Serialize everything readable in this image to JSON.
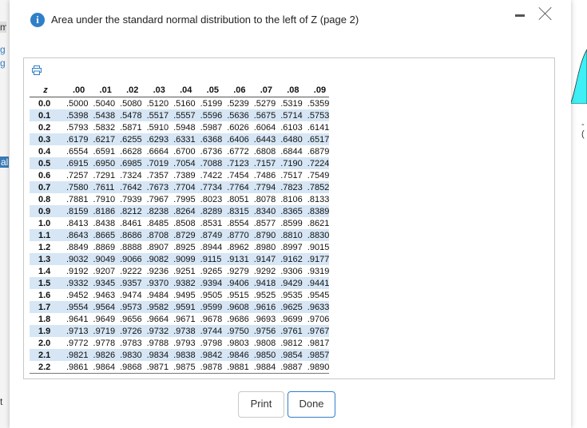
{
  "background": {
    "m_fragment": "m",
    "link_fragment_1": "g",
    "link_fragment_2": "g",
    "al_fragment": "al",
    "t_fragment": "t",
    "neg_fragment": "-("
  },
  "dialog": {
    "title": "Area under the standard normal distribution to the left of Z (page 2)",
    "info_icon": "i",
    "print_label": "Print",
    "done_label": "Done",
    "accent": "#2f7fc8",
    "row_stripe": "#d6e6f5"
  },
  "table": {
    "z_header": "z",
    "columns": [
      ".00",
      ".01",
      ".02",
      ".03",
      ".04",
      ".05",
      ".06",
      ".07",
      ".08",
      ".09"
    ],
    "rows": [
      {
        "z": "0.0",
        "values": [
          ".5000",
          ".5040",
          ".5080",
          ".5120",
          ".5160",
          ".5199",
          ".5239",
          ".5279",
          ".5319",
          ".5359"
        ]
      },
      {
        "z": "0.1",
        "values": [
          ".5398",
          ".5438",
          ".5478",
          ".5517",
          ".5557",
          ".5596",
          ".5636",
          ".5675",
          ".5714",
          ".5753"
        ]
      },
      {
        "z": "0.2",
        "values": [
          ".5793",
          ".5832",
          ".5871",
          ".5910",
          ".5948",
          ".5987",
          ".6026",
          ".6064",
          ".6103",
          ".6141"
        ]
      },
      {
        "z": "0.3",
        "values": [
          ".6179",
          ".6217",
          ".6255",
          ".6293",
          ".6331",
          ".6368",
          ".6406",
          ".6443",
          ".6480",
          ".6517"
        ]
      },
      {
        "z": "0.4",
        "values": [
          ".6554",
          ".6591",
          ".6628",
          ".6664",
          ".6700",
          ".6736",
          ".6772",
          ".6808",
          ".6844",
          ".6879"
        ]
      },
      {
        "z": "0.5",
        "values": [
          ".6915",
          ".6950",
          ".6985",
          ".7019",
          ".7054",
          ".7088",
          ".7123",
          ".7157",
          ".7190",
          ".7224"
        ]
      },
      {
        "z": "0.6",
        "values": [
          ".7257",
          ".7291",
          ".7324",
          ".7357",
          ".7389",
          ".7422",
          ".7454",
          ".7486",
          ".7517",
          ".7549"
        ]
      },
      {
        "z": "0.7",
        "values": [
          ".7580",
          ".7611",
          ".7642",
          ".7673",
          ".7704",
          ".7734",
          ".7764",
          ".7794",
          ".7823",
          ".7852"
        ]
      },
      {
        "z": "0.8",
        "values": [
          ".7881",
          ".7910",
          ".7939",
          ".7967",
          ".7995",
          ".8023",
          ".8051",
          ".8078",
          ".8106",
          ".8133"
        ]
      },
      {
        "z": "0.9",
        "values": [
          ".8159",
          ".8186",
          ".8212",
          ".8238",
          ".8264",
          ".8289",
          ".8315",
          ".8340",
          ".8365",
          ".8389"
        ]
      },
      {
        "z": "1.0",
        "values": [
          ".8413",
          ".8438",
          ".8461",
          ".8485",
          ".8508",
          ".8531",
          ".8554",
          ".8577",
          ".8599",
          ".8621"
        ]
      },
      {
        "z": "1.1",
        "values": [
          ".8643",
          ".8665",
          ".8686",
          ".8708",
          ".8729",
          ".8749",
          ".8770",
          ".8790",
          ".8810",
          ".8830"
        ]
      },
      {
        "z": "1.2",
        "values": [
          ".8849",
          ".8869",
          ".8888",
          ".8907",
          ".8925",
          ".8944",
          ".8962",
          ".8980",
          ".8997",
          ".9015"
        ]
      },
      {
        "z": "1.3",
        "values": [
          ".9032",
          ".9049",
          ".9066",
          ".9082",
          ".9099",
          ".9115",
          ".9131",
          ".9147",
          ".9162",
          ".9177"
        ]
      },
      {
        "z": "1.4",
        "values": [
          ".9192",
          ".9207",
          ".9222",
          ".9236",
          ".9251",
          ".9265",
          ".9279",
          ".9292",
          ".9306",
          ".9319"
        ]
      },
      {
        "z": "1.5",
        "values": [
          ".9332",
          ".9345",
          ".9357",
          ".9370",
          ".9382",
          ".9394",
          ".9406",
          ".9418",
          ".9429",
          ".9441"
        ]
      },
      {
        "z": "1.6",
        "values": [
          ".9452",
          ".9463",
          ".9474",
          ".9484",
          ".9495",
          ".9505",
          ".9515",
          ".9525",
          ".9535",
          ".9545"
        ]
      },
      {
        "z": "1.7",
        "values": [
          ".9554",
          ".9564",
          ".9573",
          ".9582",
          ".9591",
          ".9599",
          ".9608",
          ".9616",
          ".9625",
          ".9633"
        ]
      },
      {
        "z": "1.8",
        "values": [
          ".9641",
          ".9649",
          ".9656",
          ".9664",
          ".9671",
          ".9678",
          ".9686",
          ".9693",
          ".9699",
          ".9706"
        ]
      },
      {
        "z": "1.9",
        "values": [
          ".9713",
          ".9719",
          ".9726",
          ".9732",
          ".9738",
          ".9744",
          ".9750",
          ".9756",
          ".9761",
          ".9767"
        ]
      },
      {
        "z": "2.0",
        "values": [
          ".9772",
          ".9778",
          ".9783",
          ".9788",
          ".9793",
          ".9798",
          ".9803",
          ".9808",
          ".9812",
          ".9817"
        ]
      },
      {
        "z": "2.1",
        "values": [
          ".9821",
          ".9826",
          ".9830",
          ".9834",
          ".9838",
          ".9842",
          ".9846",
          ".9850",
          ".9854",
          ".9857"
        ]
      },
      {
        "z": "2.2",
        "values": [
          ".9861",
          ".9864",
          ".9868",
          ".9871",
          ".9875",
          ".9878",
          ".9881",
          ".9884",
          ".9887",
          ".9890"
        ]
      }
    ]
  },
  "icons": {
    "info": "info-icon",
    "minimize": "minimize-icon",
    "close": "close-icon",
    "print": "printer-icon"
  }
}
